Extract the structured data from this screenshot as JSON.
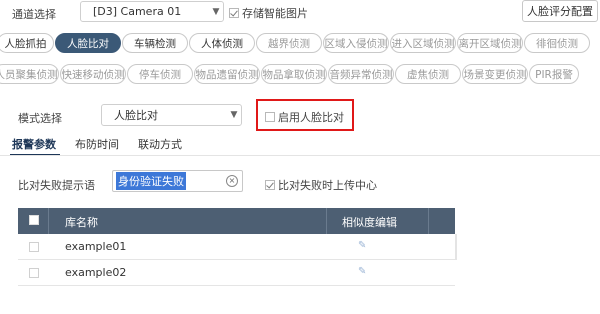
{
  "channel": {
    "label": "通道选择",
    "value": "[D3] Camera 01"
  },
  "store_pic": {
    "label": "存储智能图片",
    "checked": true
  },
  "score_btn": {
    "label": "人脸评分配置"
  },
  "detect_tabs_row1": [
    {
      "label": "人脸抓拍",
      "state": "normal"
    },
    {
      "label": "人脸比对",
      "state": "active"
    },
    {
      "label": "车辆检测",
      "state": "normal"
    },
    {
      "label": "人体侦测",
      "state": "normal"
    },
    {
      "label": "越界侦测",
      "state": "disabled"
    },
    {
      "label": "区域入侵侦测",
      "state": "disabled"
    },
    {
      "label": "进入区域侦测",
      "state": "disabled"
    },
    {
      "label": "离开区域侦测",
      "state": "disabled"
    },
    {
      "label": "徘徊侦测",
      "state": "disabled"
    }
  ],
  "detect_tabs_row2": [
    {
      "label": "人员聚集侦测",
      "state": "disabled"
    },
    {
      "label": "快速移动侦测",
      "state": "disabled"
    },
    {
      "label": "停车侦测",
      "state": "disabled"
    },
    {
      "label": "物品遗留侦测",
      "state": "disabled"
    },
    {
      "label": "物品拿取侦测",
      "state": "disabled"
    },
    {
      "label": "音频异常侦测",
      "state": "disabled"
    },
    {
      "label": "虚焦侦测",
      "state": "disabled"
    },
    {
      "label": "场景变更侦测",
      "state": "disabled"
    },
    {
      "label": "PIR报警",
      "state": "disabled"
    }
  ],
  "mode": {
    "label": "模式选择",
    "value": "人脸比对"
  },
  "enable_face": {
    "label": "启用人脸比对",
    "checked": false
  },
  "sub_tabs": [
    "报警参数",
    "布防时间",
    "联动方式"
  ],
  "fail_prompt": {
    "label": "比对失败提示语",
    "value": "身份验证失败"
  },
  "upload_fail": {
    "label": "比对失败时上传中心",
    "checked": true
  },
  "table": {
    "col_name": "库名称",
    "col_similarity": "相似度编辑",
    "rows": [
      {
        "name": "example01",
        "checked": false
      },
      {
        "name": "example02",
        "checked": false
      }
    ]
  },
  "colors": {
    "active_pill": "#3b5977",
    "table_header": "#4d5f73",
    "highlight_box": "#e01818",
    "input_selection": "#3d78d8"
  }
}
